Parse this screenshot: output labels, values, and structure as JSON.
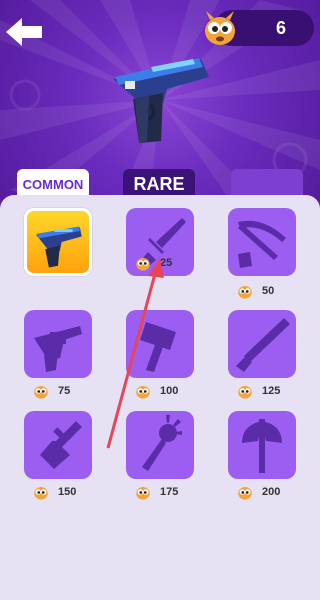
{
  "header": {
    "currency_amount": "6"
  },
  "tabs": [
    {
      "label": "COMMON",
      "active": true
    },
    {
      "label": "RARE",
      "active": false
    },
    {
      "label": "",
      "active": false
    }
  ],
  "icons": {
    "back": "back-arrow-icon",
    "currency": "mascot-coin-icon",
    "weapons": [
      "pistol",
      "dagger",
      "crossbow",
      "revolver",
      "hammer",
      "shotgun",
      "finger-gun",
      "mace",
      "battle-axe"
    ]
  },
  "items": [
    {
      "price": "",
      "selected": true
    },
    {
      "price": "25"
    },
    {
      "price": "50"
    },
    {
      "price": "75"
    },
    {
      "price": "100"
    },
    {
      "price": "125"
    },
    {
      "price": "150"
    },
    {
      "price": "175"
    },
    {
      "price": "200"
    }
  ],
  "colors": {
    "accent": "#6b2bd0",
    "tile": "#9b5ef0",
    "selected": "#ffc21a",
    "arrow": "#e8455a"
  }
}
